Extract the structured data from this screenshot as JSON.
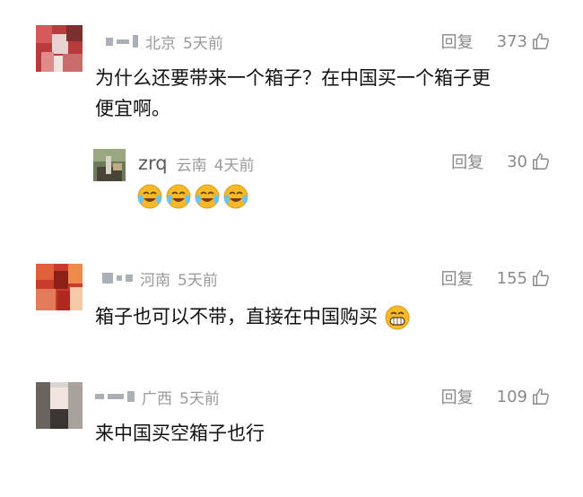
{
  "comments": [
    {
      "location": "北京",
      "time": "5天前",
      "reply_label": "回复",
      "likes": "373",
      "text_line1": "为什么还要带来一个箱子？在中国买一个箱子更",
      "text_line2": "便宜啊。",
      "avatar_colors": [
        "#c94b4b",
        "#e9c4c4",
        "#7b2f2f"
      ],
      "reply": {
        "username": "zrq",
        "location": "云南",
        "time": "4天前",
        "reply_label": "回复",
        "likes": "30",
        "emoji_icons": [
          "crying-laughing-icon",
          "crying-laughing-icon",
          "crying-laughing-icon",
          "crying-laughing-icon"
        ]
      }
    },
    {
      "location": "河南",
      "time": "5天前",
      "reply_label": "回复",
      "likes": "155",
      "text": "箱子也可以不带，直接在中国购买",
      "trailing_emoji": "grinning-icon"
    },
    {
      "location": "广西",
      "time": "5天前",
      "reply_label": "回复",
      "likes": "109",
      "text": "来中国买空箱子也行"
    }
  ],
  "colors": {
    "meta": "#9a9a9a",
    "text": "#111111",
    "emoji_yellow": "#f5b92a"
  },
  "icons": {
    "like": "thumb-up-icon"
  }
}
